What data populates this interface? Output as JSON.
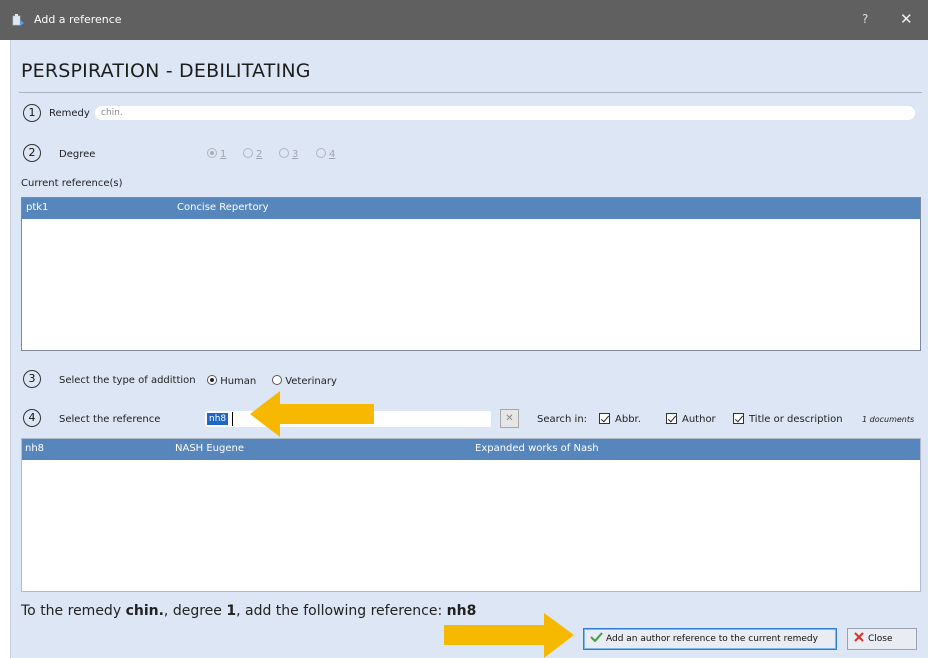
{
  "window": {
    "title": "Add a reference",
    "help_label": "?",
    "close_glyph": "✕"
  },
  "heading": "PERSPIRATION - DEBILITATING",
  "steps": [
    "1",
    "2",
    "3",
    "4"
  ],
  "remedy": {
    "label": "Remedy",
    "value": "chin."
  },
  "degree": {
    "label": "Degree",
    "options": [
      "1",
      "2",
      "3",
      "4"
    ],
    "selected": "1"
  },
  "current_refs": {
    "label": "Current reference(s)",
    "header": [
      "ptk1",
      "Concise Repertory"
    ]
  },
  "type_select": {
    "label": "Select the type of addittion",
    "options": [
      "Human",
      "Veterinary"
    ],
    "selected": "Human"
  },
  "reference_select": {
    "label": "Select the reference",
    "value": "nh8",
    "clear_glyph": "✕",
    "search_in_label": "Search in:",
    "checkboxes": [
      "Abbr.",
      "Author",
      "Title or description"
    ],
    "count": "1 documents"
  },
  "results": {
    "header": [
      "nh8",
      "NASH Eugene",
      "Expanded works of Nash"
    ]
  },
  "summary": {
    "prefix": "To the remedy ",
    "remedy": "chin.",
    "mid": ", degree ",
    "degree": "1",
    "mid2": ", add the following reference: ",
    "reference": "nh8"
  },
  "buttons": {
    "add": "Add an author reference to the current remedy",
    "close": "Close"
  },
  "colors": {
    "header_blue": "#5786bd",
    "arrow": "#f7b900",
    "dialog_bg": "#dde6f4",
    "titlebar": "#606060"
  }
}
